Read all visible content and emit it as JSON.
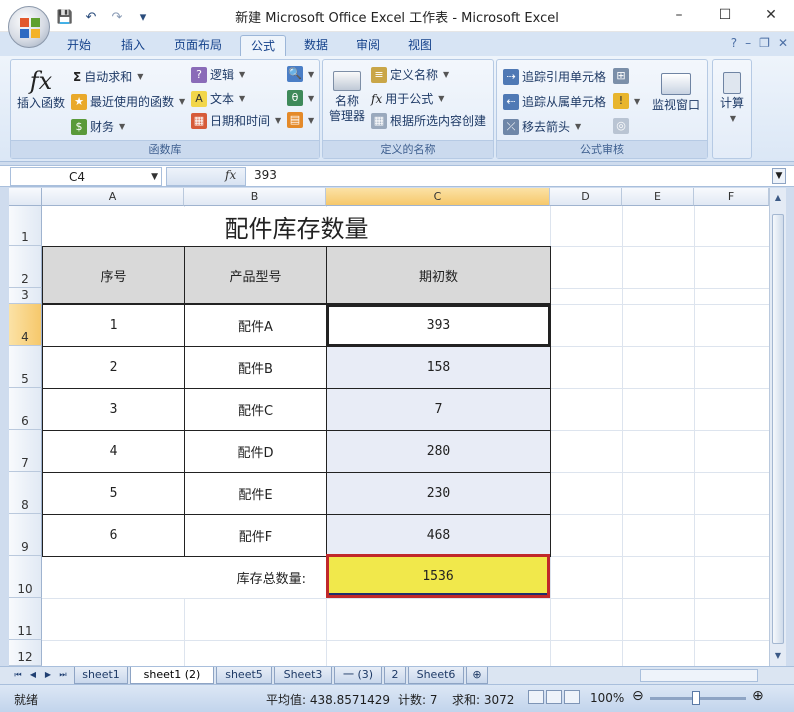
{
  "window": {
    "title": "新建 Microsoft Office Excel 工作表 - Microsoft Excel",
    "minimize": "–",
    "maximize": "☐",
    "close": "✕"
  },
  "qat": {
    "save": "💾",
    "undo": "↶",
    "redo": "↷",
    "customize": "▾"
  },
  "tabs": [
    {
      "label": "开始"
    },
    {
      "label": "插入"
    },
    {
      "label": "页面布局"
    },
    {
      "label": "公式"
    },
    {
      "label": "数据"
    },
    {
      "label": "审阅"
    },
    {
      "label": "视图"
    }
  ],
  "tab_right": {
    "help": "?",
    "min": "–",
    "restore": "❐",
    "close": "✕"
  },
  "ribbon": {
    "function_library": {
      "label": "函数库",
      "insert_function": "插入函数",
      "autosum": "自动求和",
      "recent": "最近使用的函数",
      "financial": "财务",
      "logical": "逻辑",
      "text": "文本",
      "datetime": "日期和时间"
    },
    "defined_names": {
      "label": "定义的名称",
      "name_manager_1": "名称",
      "name_manager_2": "管理器",
      "define_name": "定义名称",
      "use_in_formula": "用于公式",
      "create_from_selection": "根据所选内容创建"
    },
    "formula_auditing": {
      "label": "公式审核",
      "trace_precedents": "追踪引用单元格",
      "trace_dependents": "追踪从属单元格",
      "remove_arrows": "移去箭头",
      "watch_window": "监视窗口"
    },
    "calculation": {
      "label": "计算"
    }
  },
  "formula_bar": {
    "name_box": "C4",
    "fx": "fx",
    "value": "393"
  },
  "columns": [
    "A",
    "B",
    "C",
    "D",
    "E",
    "F"
  ],
  "rows": [
    "1",
    "2",
    "3",
    "4",
    "5",
    "6",
    "7",
    "8",
    "9",
    "10",
    "11",
    "12"
  ],
  "sheet": {
    "title": "配件库存数量",
    "header_seq": "序号",
    "header_model": "产品型号",
    "header_qty": "期初数",
    "items": [
      {
        "seq": "1",
        "model": "配件A",
        "qty": "393"
      },
      {
        "seq": "2",
        "model": "配件B",
        "qty": "158"
      },
      {
        "seq": "3",
        "model": "配件C",
        "qty": "7"
      },
      {
        "seq": "4",
        "model": "配件D",
        "qty": "280"
      },
      {
        "seq": "5",
        "model": "配件E",
        "qty": "230"
      },
      {
        "seq": "6",
        "model": "配件F",
        "qty": "468"
      }
    ],
    "total_label": "库存总数量:",
    "total_value": "1536"
  },
  "sheet_tabs": [
    "sheet1",
    "sheet1 (2)",
    "sheet5",
    "Sheet3",
    "一 (3)",
    "2",
    "Sheet6"
  ],
  "status": {
    "ready": "就绪",
    "average": "平均值: 438.8571429",
    "count": "计数: 7",
    "sum": "求和: 3072",
    "zoom": "100%"
  },
  "colors": {
    "highlight_fill": "#f1e84b",
    "highlight_border": "#c0282a",
    "selected_col": "#f6c86b"
  }
}
